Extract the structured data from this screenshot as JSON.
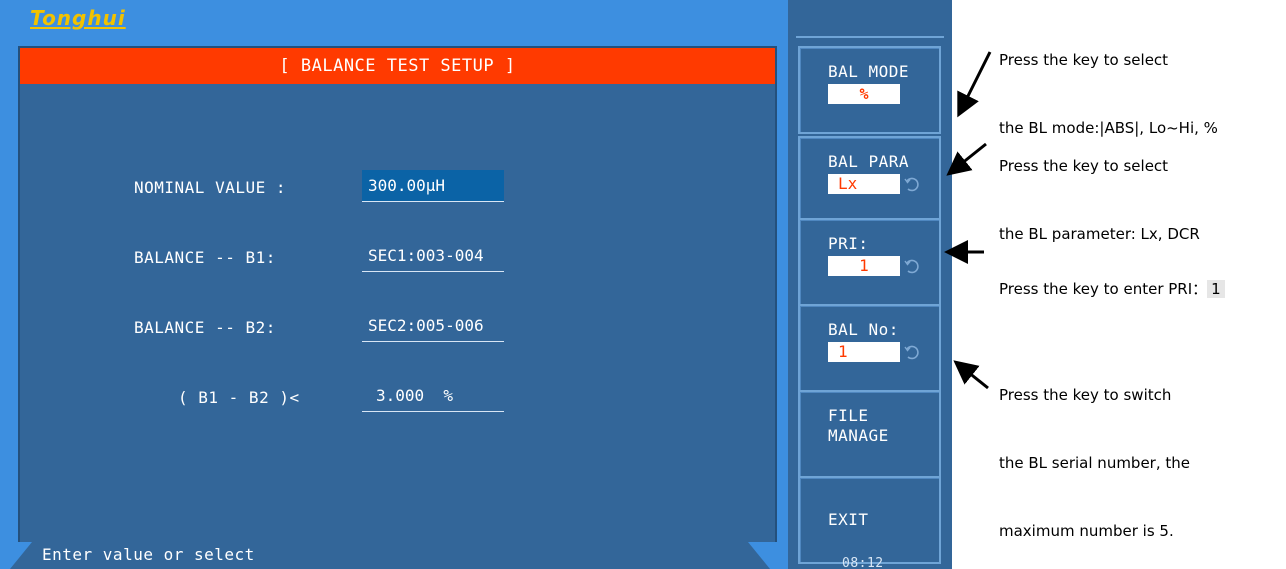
{
  "logo": "Tonghui",
  "panel": {
    "title": "[ BALANCE TEST SETUP ]",
    "fields": [
      {
        "label": "NOMINAL VALUE :",
        "value": "300.00µH"
      },
      {
        "label": "BALANCE -- B1:",
        "value": "SEC1:003-004"
      },
      {
        "label": "BALANCE -- B2:",
        "value": "SEC2:005-006"
      },
      {
        "label": "( B1 - B2 )<",
        "value": "3.000  %"
      }
    ],
    "status": "Enter value or select"
  },
  "softkeys": {
    "bal_mode": {
      "label": "BAL MODE",
      "value": "%"
    },
    "bal_para": {
      "label": "BAL PARA",
      "value": "Lx"
    },
    "pri": {
      "label": "PRI:",
      "value": "1"
    },
    "bal_no": {
      "label": "BAL No:",
      "value": "1"
    },
    "file_manage": {
      "line1": "FILE",
      "line2": "MANAGE"
    },
    "exit": {
      "label": "EXIT"
    }
  },
  "clock": "08:12",
  "annotations": {
    "bal_mode": {
      "line1": "Press the key to select",
      "line2": "the BL mode:|ABS|, Lo~Hi, %"
    },
    "bal_para": {
      "line1": "Press the key to select",
      "line2": "the BL parameter: Lx, DCR"
    },
    "pri": {
      "text": "Press the key to enter PRI：",
      "value": "1"
    },
    "bal_no": {
      "line1": "Press the key to switch",
      "line2": "the BL serial number, the",
      "line3": "maximum number is 5."
    }
  },
  "colors": {
    "screen_bg": "#3d8fe0",
    "panel_bg": "#336699",
    "title_bar": "#ff3a00",
    "logo": "#f2c200",
    "selected_field": "#0b63a6"
  }
}
